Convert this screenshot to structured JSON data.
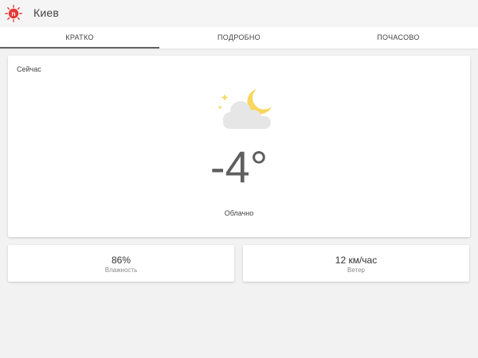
{
  "header": {
    "city": "Киев",
    "logo_icon": "sun-logo-icon",
    "logo_letter": "n",
    "brand_color": "#e53935"
  },
  "tabs": [
    {
      "label": "КРАТКО",
      "active": true
    },
    {
      "label": "ПОДРОБНО",
      "active": false
    },
    {
      "label": "ПОЧАСОВО",
      "active": false
    }
  ],
  "current": {
    "label": "Сейчас",
    "icon": "cloudy-night-icon",
    "temperature": "-4°",
    "condition": "Облачно"
  },
  "stats": {
    "humidity": {
      "value": "86%",
      "label": "Влажность"
    },
    "wind": {
      "value": "12 км/час",
      "label": "Ветер"
    }
  },
  "colors": {
    "background": "#f2f2f2",
    "card": "#ffffff",
    "moon": "#f9d65c",
    "cloud": "#e6e6e6",
    "text": "#5f5f5f"
  }
}
